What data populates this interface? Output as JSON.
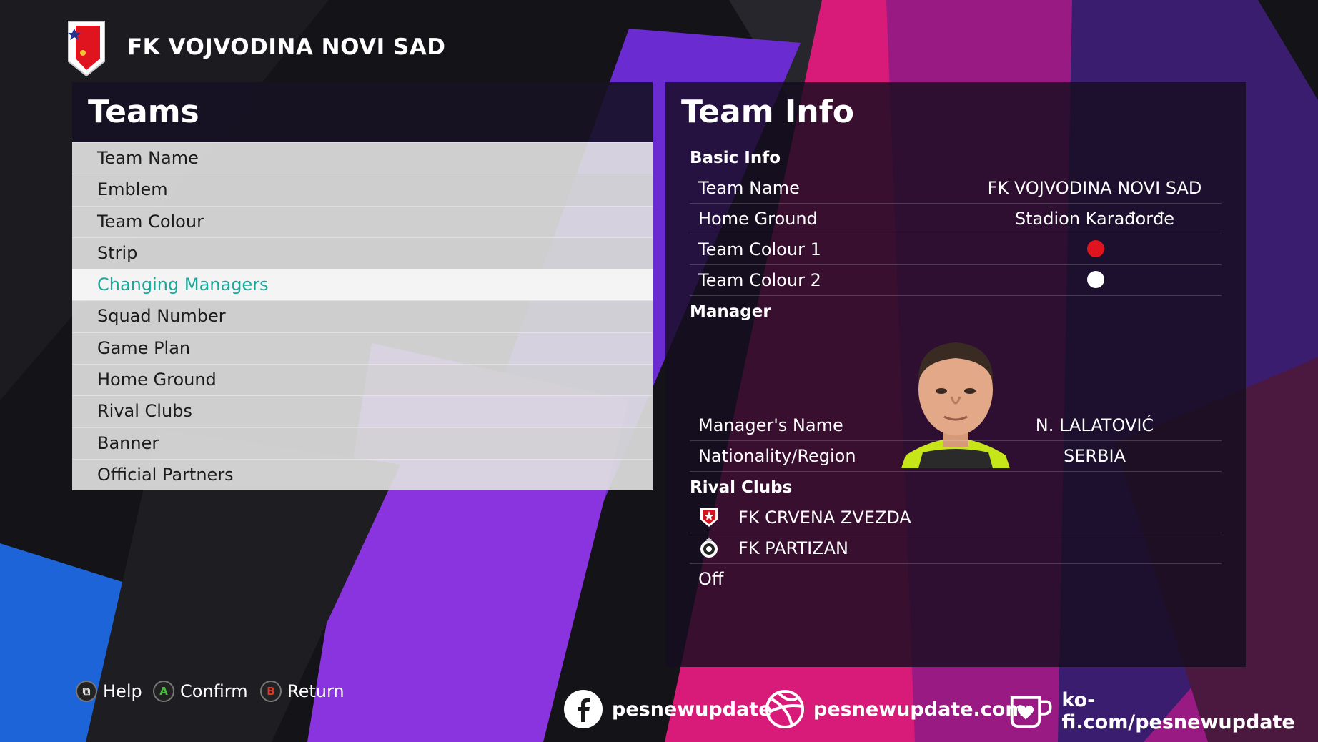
{
  "header": {
    "club_name": "FK VOJVODINA NOVI SAD",
    "crest_icon": "vojvodina-crest-icon"
  },
  "teams_panel": {
    "title": "Teams",
    "items": [
      {
        "label": "Team Name"
      },
      {
        "label": "Emblem"
      },
      {
        "label": "Team Colour"
      },
      {
        "label": "Strip"
      },
      {
        "label": "Changing Managers",
        "selected": true
      },
      {
        "label": "Squad Number"
      },
      {
        "label": "Game Plan"
      },
      {
        "label": "Home Ground"
      },
      {
        "label": "Rival Clubs"
      },
      {
        "label": "Banner"
      },
      {
        "label": "Official Partners"
      }
    ]
  },
  "info_panel": {
    "title": "Team Info",
    "basic_info": {
      "heading": "Basic Info",
      "team_name_label": "Team Name",
      "team_name_value": "FK VOJVODINA NOVI SAD",
      "home_ground_label": "Home Ground",
      "home_ground_value": "Stadion Karađorđe",
      "colour1_label": "Team Colour 1",
      "colour1": "#e0141e",
      "colour2_label": "Team Colour 2",
      "colour2": "#ffffff"
    },
    "manager": {
      "heading": "Manager",
      "name_label": "Manager's Name",
      "name_value": "N. LALATOVIĆ",
      "nationality_label": "Nationality/Region",
      "nationality_value": "SERBIA"
    },
    "rival_clubs": {
      "heading": "Rival Clubs",
      "clubs": [
        {
          "name": "FK CRVENA ZVEZDA",
          "icon": "crvena-zvezda-crest-icon"
        },
        {
          "name": "FK PARTIZAN",
          "icon": "partizan-crest-icon"
        }
      ],
      "status": "Off"
    }
  },
  "footer": {
    "help": {
      "glyph": "⧉",
      "label": "Help"
    },
    "confirm": {
      "glyph": "A",
      "label": "Confirm"
    },
    "return": {
      "glyph": "B",
      "label": "Return"
    },
    "social": {
      "facebook": "pesnewupdate",
      "website": "pesnewupdate.com",
      "kofi": "ko-fi.com/pesnewupdate"
    }
  },
  "colors": {
    "accent_selected": "#1aa89a",
    "magenta": "#e0167a",
    "purple": "#7a2ad8",
    "blue": "#1d6fe6"
  }
}
